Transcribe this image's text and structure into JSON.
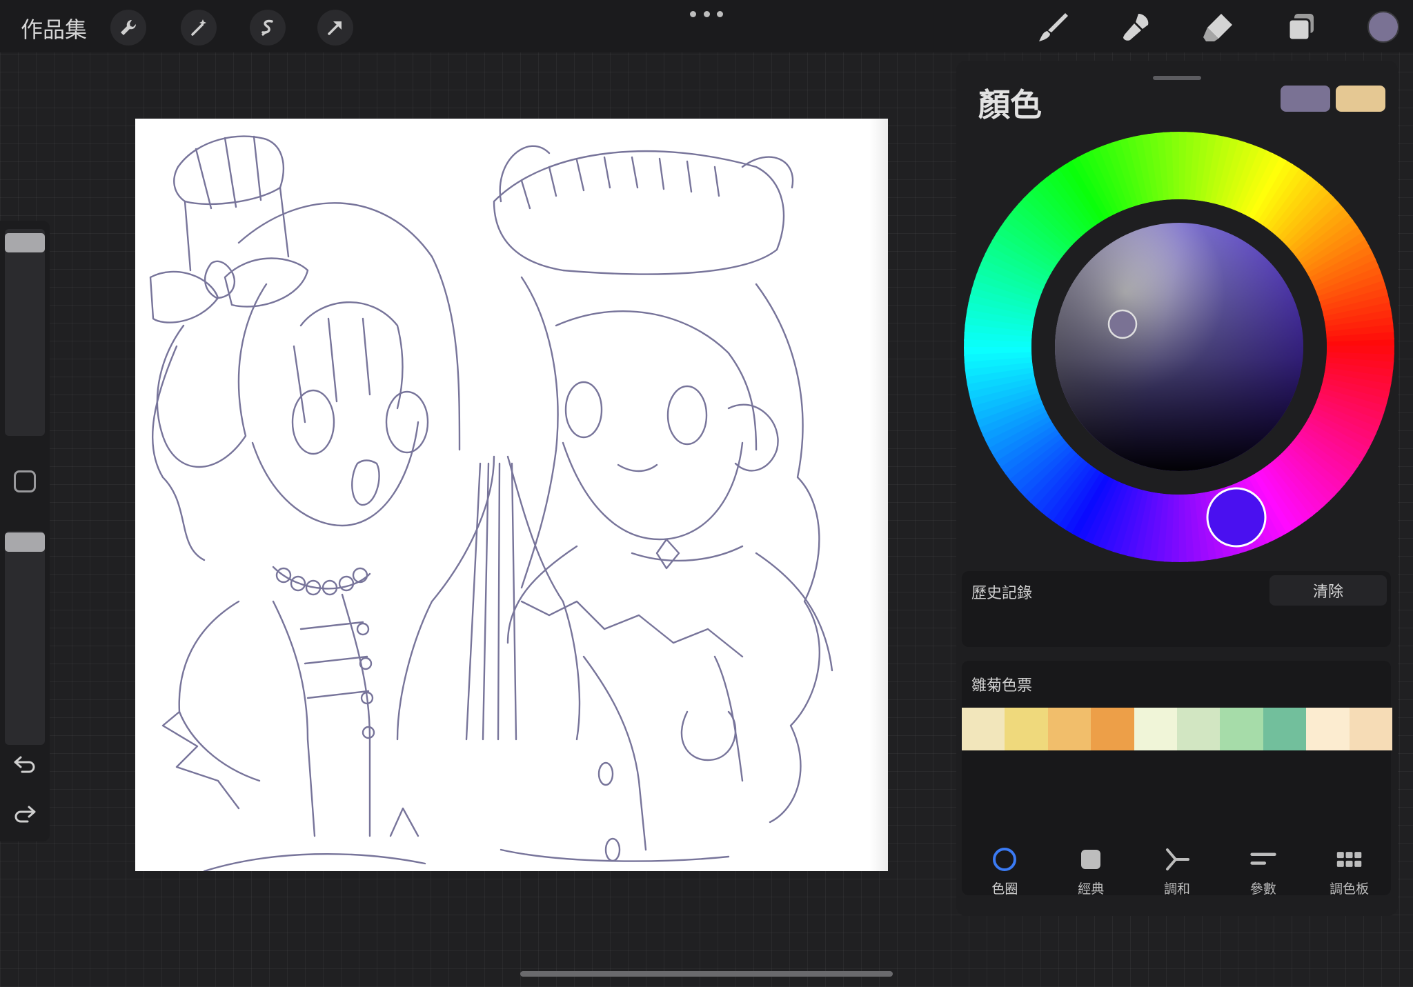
{
  "topbar": {
    "gallery_label": "作品集",
    "tools_left": [
      "wrench-icon",
      "magic-wand-icon",
      "selection-icon",
      "transform-arrow-icon"
    ],
    "tools_right": [
      "brush-icon",
      "smudge-icon",
      "eraser-icon",
      "layers-icon"
    ],
    "current_color": "#7a7294"
  },
  "sidebar": {
    "brush_size_level": 0.92,
    "opacity_level": 0.92
  },
  "panel": {
    "title": "顏色",
    "primary_color": "#7a7294",
    "secondary_color": "#e5c893",
    "history_label": "歷史記錄",
    "clear_label": "清除",
    "palette_label": "雛菊色票",
    "palette": [
      "#f2e6bb",
      "#efd97c",
      "#f1be6b",
      "#ed9f48",
      "#f0f5d8",
      "#d2e6c2",
      "#a6dca9",
      "#72bf9c",
      "#fcecd0",
      "#f6dcb6"
    ],
    "tabs": [
      {
        "label": "色圈",
        "icon": "disc-icon",
        "active": true
      },
      {
        "label": "經典",
        "icon": "square-icon",
        "active": false
      },
      {
        "label": "調和",
        "icon": "harmony-icon",
        "active": false
      },
      {
        "label": "參數",
        "icon": "sliders-icon",
        "active": false
      },
      {
        "label": "調色板",
        "icon": "grid-icon",
        "active": false
      }
    ]
  }
}
